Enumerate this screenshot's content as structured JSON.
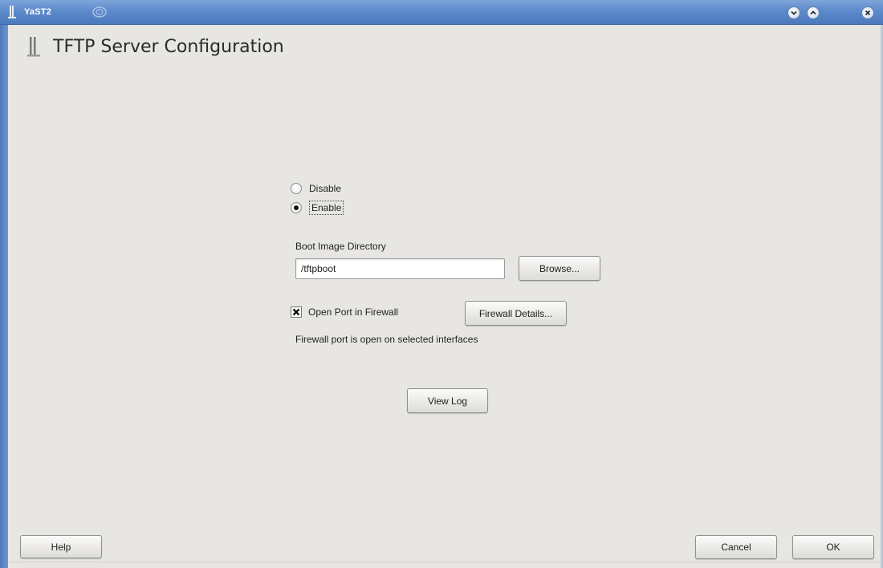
{
  "window": {
    "title": "YaST2",
    "colors": {
      "titlebar": "#5d8acb",
      "background": "#e8e6e2"
    }
  },
  "header": {
    "title": "TFTP Server Configuration",
    "icon": "yast-module-icon"
  },
  "service": {
    "options": [
      {
        "label": "Disable",
        "selected": false
      },
      {
        "label": "Enable",
        "selected": true
      }
    ]
  },
  "boot_image": {
    "label": "Boot Image Directory",
    "value": "/tftpboot",
    "browse_label": "Browse..."
  },
  "firewall": {
    "checkbox_label": "Open Port in Firewall",
    "checked": true,
    "details_label": "Firewall Details...",
    "status": "Firewall port is open on selected interfaces"
  },
  "view_log_label": "View Log",
  "footer": {
    "help_label": "Help",
    "cancel_label": "Cancel",
    "ok_label": "OK"
  }
}
